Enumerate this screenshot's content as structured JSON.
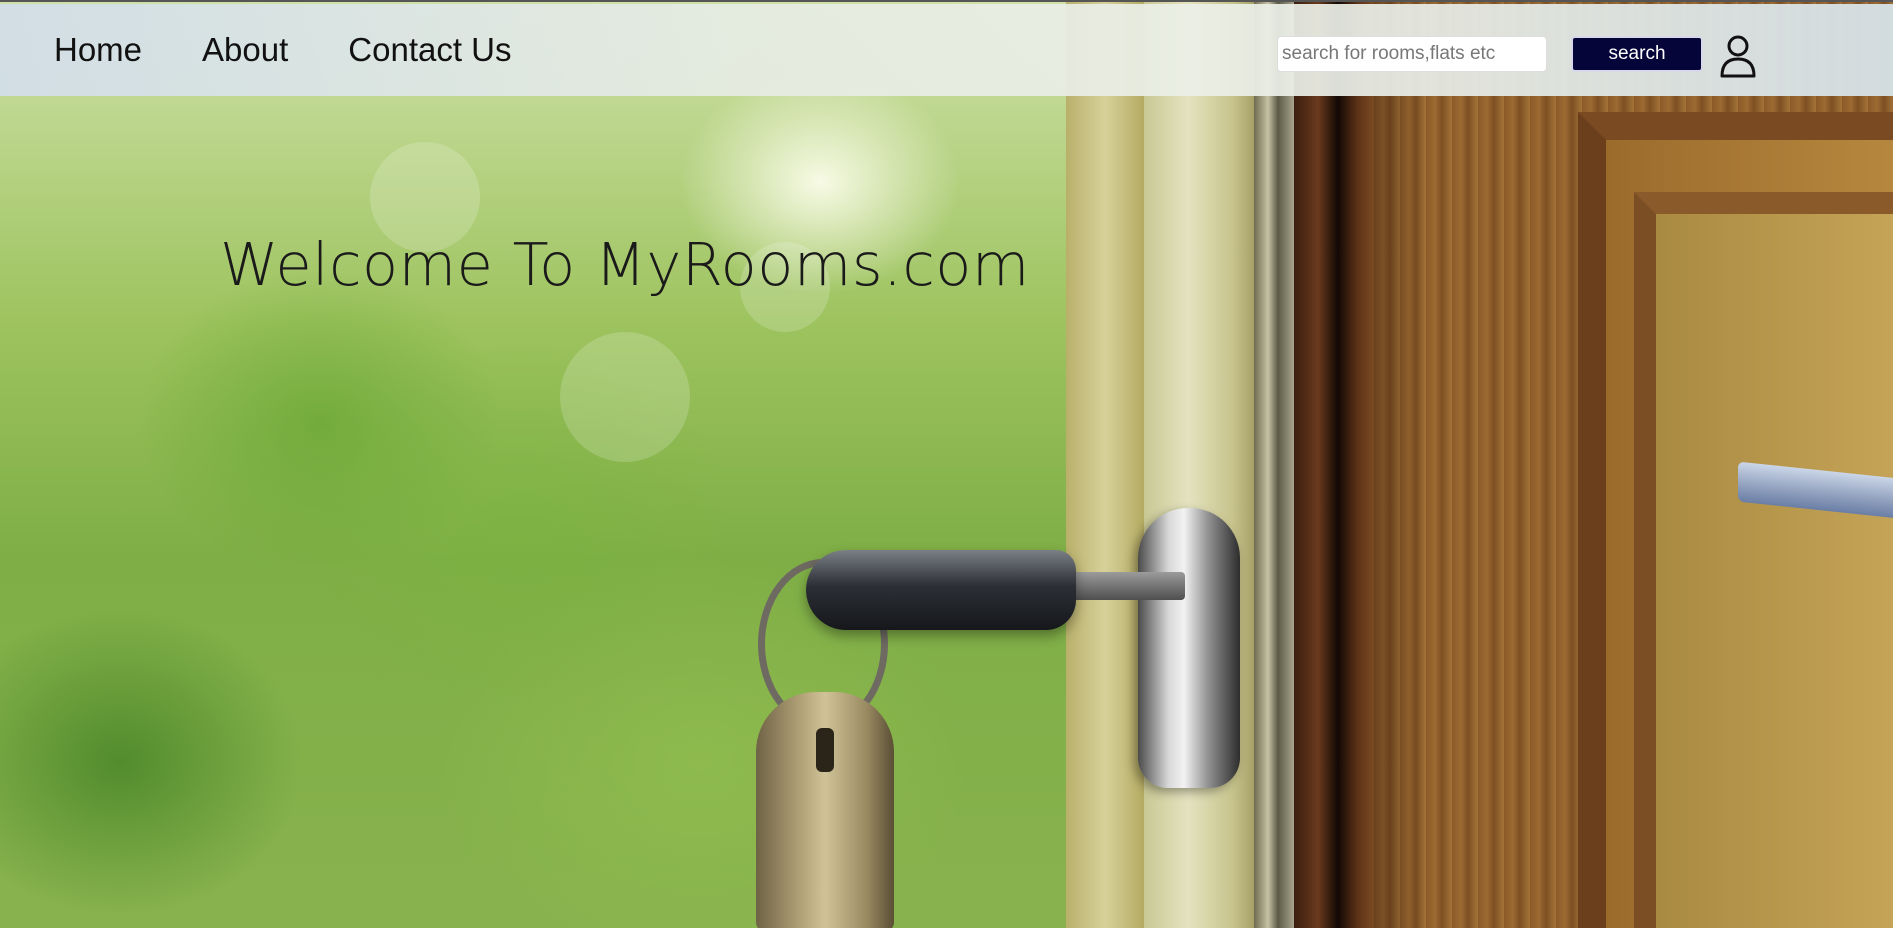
{
  "navbar": {
    "links": [
      {
        "label": "Home"
      },
      {
        "label": "About"
      },
      {
        "label": "Contact Us"
      }
    ],
    "search": {
      "placeholder": "search for rooms,flats etc",
      "value": "",
      "button_label": "search"
    },
    "user_icon": "user-icon"
  },
  "hero": {
    "heading": "Welcome To MyRooms.com",
    "background": "photo of a key in a door lock with green blurred garden"
  },
  "colors": {
    "search_button_bg": "#05053a",
    "heading_text": "#1a1a1a"
  }
}
